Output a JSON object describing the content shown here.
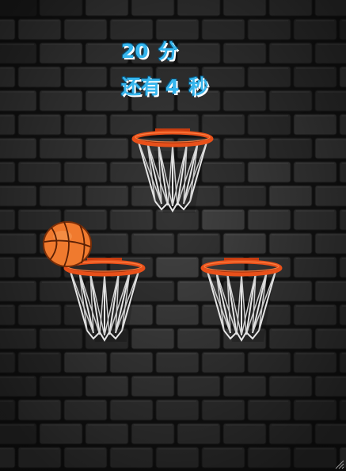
{
  "hud": {
    "score_value": "20",
    "score_unit": "分",
    "time_prefix": "还有",
    "time_value": "4",
    "time_unit": "秒"
  },
  "colors": {
    "hud_text": "#36b6ee",
    "rim": "#e8501a",
    "net": "#e6e6e6",
    "ball": "#f07a2e",
    "wall": "#3a3a3a"
  },
  "hoops": [
    "hoop-top",
    "hoop-left",
    "hoop-right"
  ],
  "ball_icon": "basketball-icon"
}
